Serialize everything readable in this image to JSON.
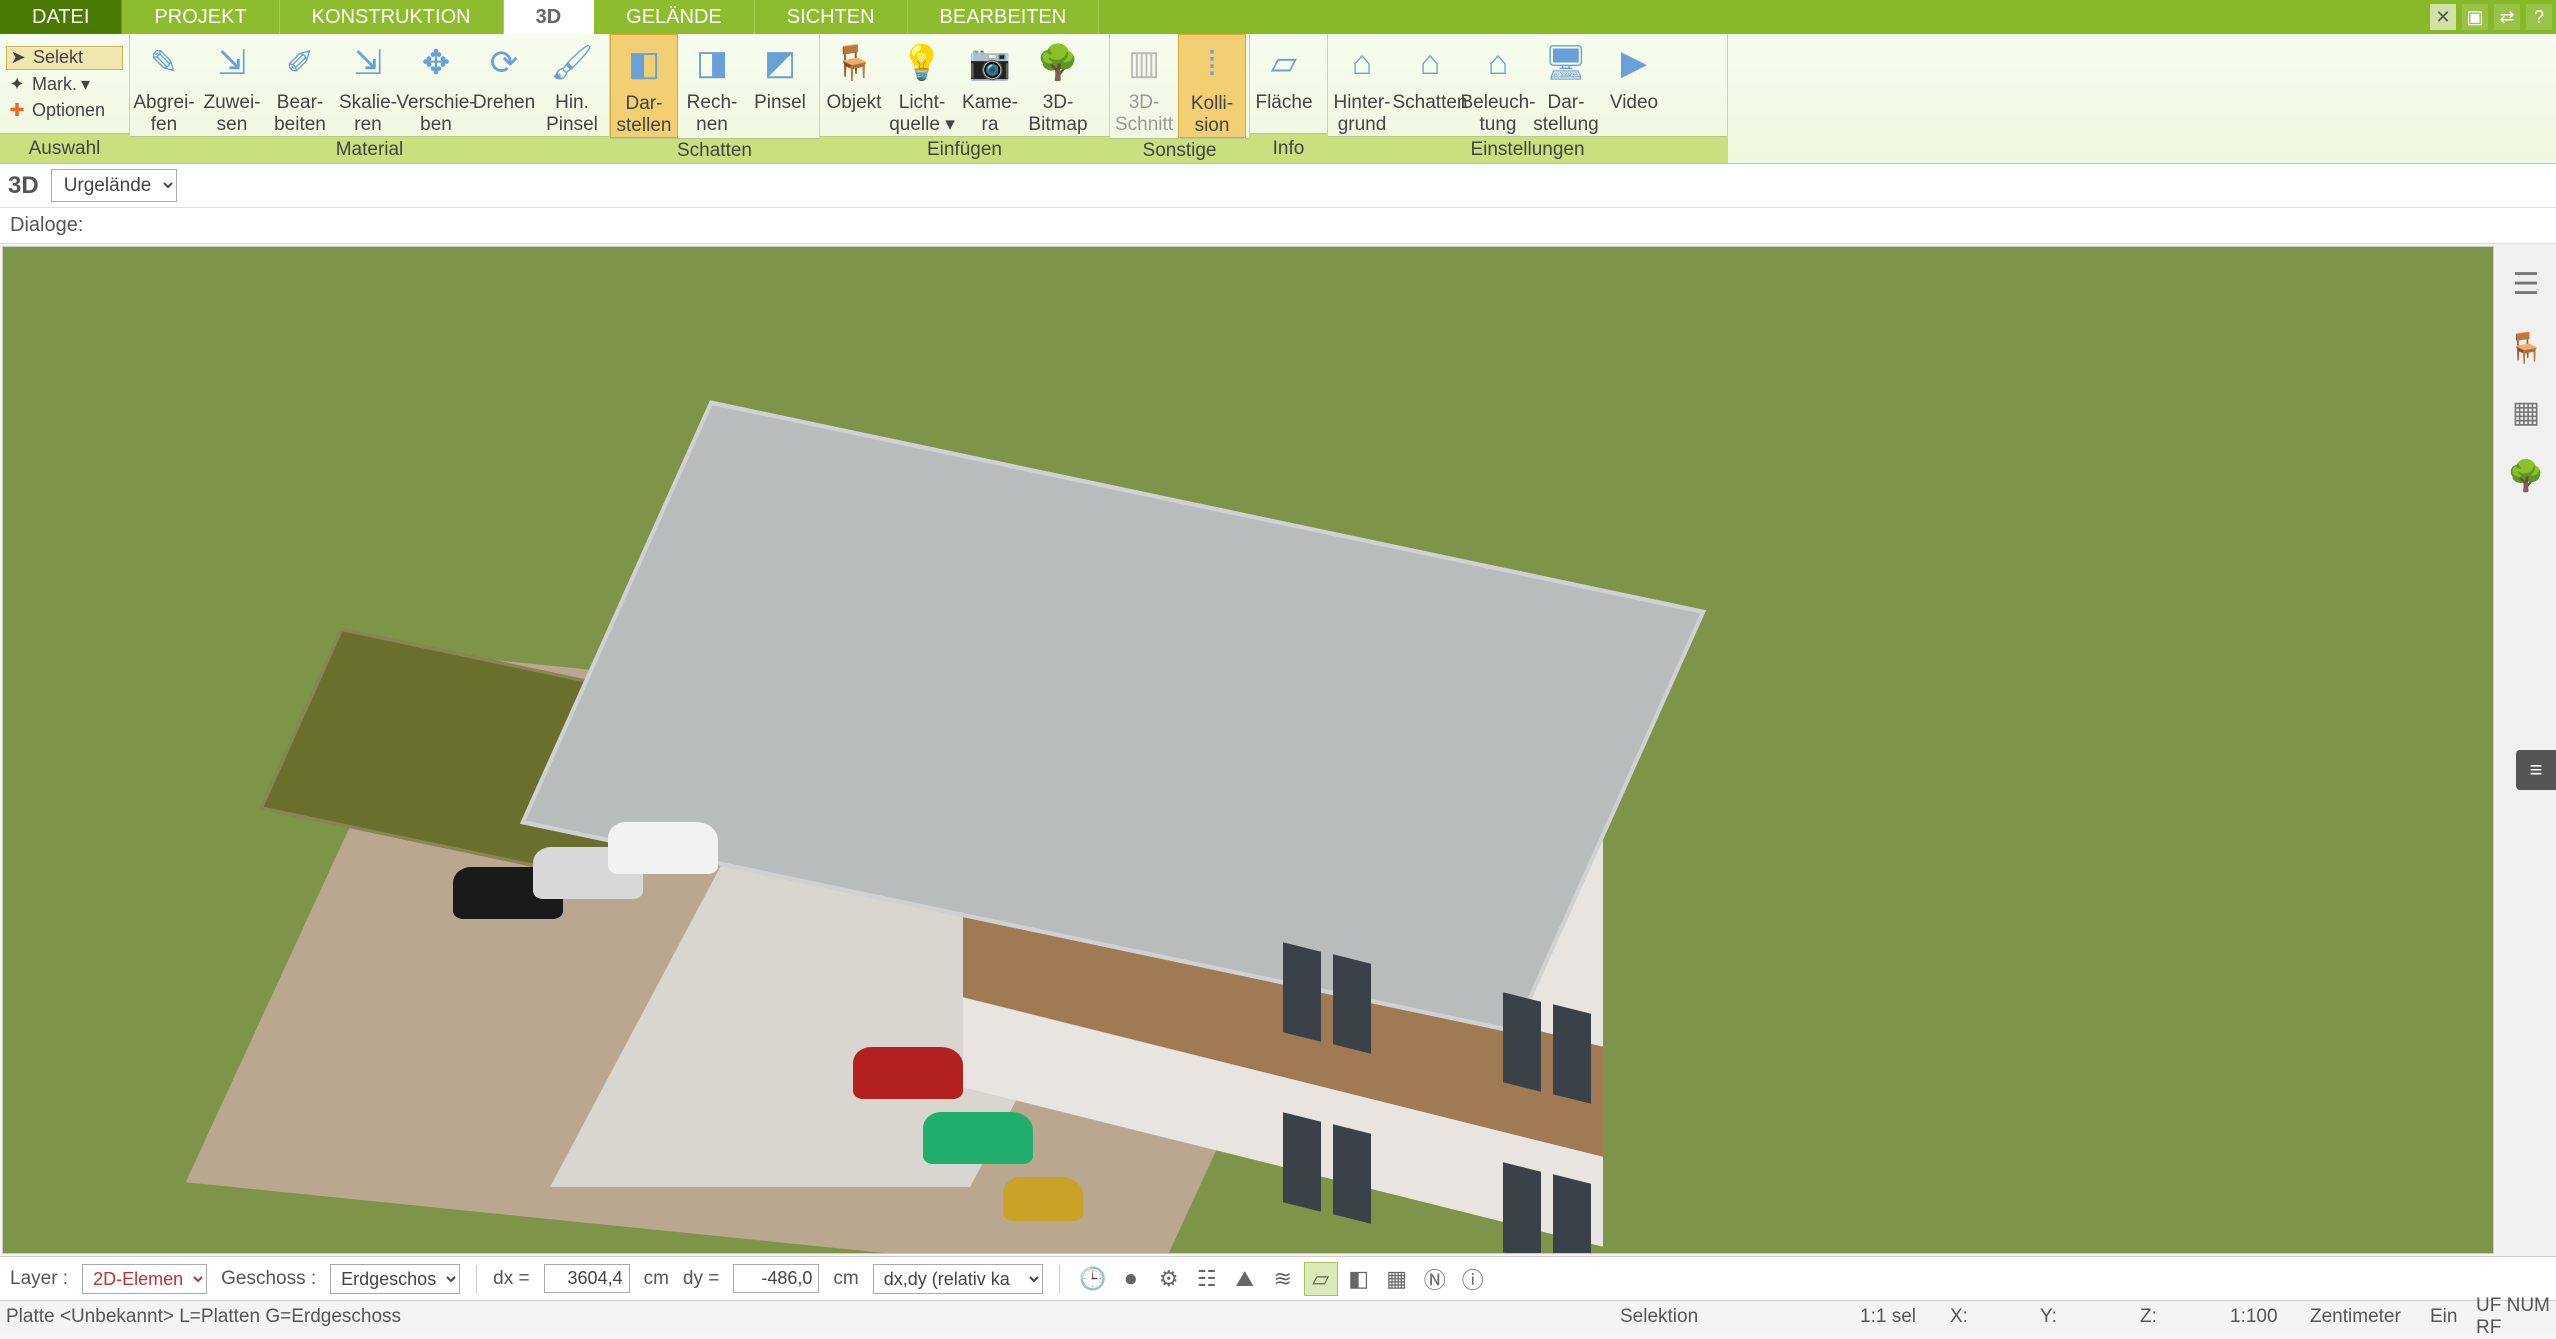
{
  "menu": {
    "tabs": [
      "DATEI",
      "PROJEKT",
      "KONSTRUKTION",
      "3D",
      "GELÄNDE",
      "SICHTEN",
      "BEARBEITEN"
    ],
    "active": "3D"
  },
  "title_icons": [
    "pin-icon",
    "layer-icon",
    "swap-icon",
    "help-icon",
    "minimize-icon",
    "restore-icon",
    "close-icon"
  ],
  "ribbon": {
    "auswahl": {
      "selekt": "Selekt",
      "mark": "Mark.",
      "optionen": "Optionen",
      "label": "Auswahl"
    },
    "material": {
      "tools": [
        {
          "id": "abgreifen",
          "l1": "Abgrei-",
          "l2": "fen",
          "icon": "eyedropper-icon"
        },
        {
          "id": "zuweisen",
          "l1": "Zuwei-",
          "l2": "sen",
          "icon": "assign-icon"
        },
        {
          "id": "bearbeiten",
          "l1": "Bear-",
          "l2": "beiten",
          "icon": "edit-icon"
        },
        {
          "id": "skalieren",
          "l1": "Skalie-",
          "l2": "ren",
          "icon": "scale-icon"
        },
        {
          "id": "verschieben",
          "l1": "Verschie-",
          "l2": "ben",
          "icon": "move-icon"
        },
        {
          "id": "drehen",
          "l1": "Drehen",
          "l2": "",
          "icon": "rotate-icon"
        },
        {
          "id": "hinpinsel",
          "l1": "Hin.",
          "l2": "Pinsel",
          "icon": "brush-icon"
        }
      ],
      "label": "Material"
    },
    "schatten": {
      "tools": [
        {
          "id": "darstellen",
          "l1": "Dar-",
          "l2": "stellen",
          "icon": "cube-icon",
          "active": true
        },
        {
          "id": "rechnen",
          "l1": "Rech-",
          "l2": "nen",
          "icon": "cube2-icon"
        },
        {
          "id": "pinsel",
          "l1": "Pinsel",
          "l2": "",
          "icon": "cube3-icon"
        }
      ],
      "label": "Schatten"
    },
    "einfuegen": {
      "tools": [
        {
          "id": "objekt",
          "l1": "Objekt",
          "l2": "",
          "icon": "chair-icon"
        },
        {
          "id": "lichtquelle",
          "l1": "Licht-",
          "l2": "quelle ▾",
          "icon": "bulb-icon"
        },
        {
          "id": "kamera",
          "l1": "Kame-",
          "l2": "ra",
          "icon": "camera-icon"
        },
        {
          "id": "3dbitmap",
          "l1": "3D-",
          "l2": "Bitmap",
          "icon": "tree-icon"
        }
      ],
      "label": "Einfügen"
    },
    "sonstige": {
      "tools": [
        {
          "id": "3dschnitt",
          "l1": "3D-",
          "l2": "Schnitt",
          "icon": "section-icon",
          "disabled": true
        },
        {
          "id": "kollision",
          "l1": "Kolli-",
          "l2": "sion",
          "icon": "collision-icon",
          "active": true
        }
      ],
      "label": "Sonstige"
    },
    "info": {
      "tools": [
        {
          "id": "flaeche",
          "l1": "Fläche",
          "l2": "",
          "icon": "area-icon"
        }
      ],
      "label": "Info"
    },
    "einstellungen": {
      "tools": [
        {
          "id": "hintergrund",
          "l1": "Hinter-",
          "l2": "grund",
          "icon": "house-bg-icon"
        },
        {
          "id": "schatten2",
          "l1": "Schatten",
          "l2": "",
          "icon": "house-shadow-icon"
        },
        {
          "id": "beleuchtung",
          "l1": "Beleuch-",
          "l2": "tung",
          "icon": "house-light-icon"
        },
        {
          "id": "darstellung",
          "l1": "Dar-",
          "l2": "stellung",
          "icon": "monitor-icon"
        },
        {
          "id": "video",
          "l1": "Video",
          "l2": "",
          "icon": "play-icon"
        }
      ],
      "label": "Einstellungen"
    }
  },
  "view": {
    "badge": "3D",
    "layer": "Urgelände"
  },
  "dialoge_label": "Dialoge:",
  "side_tools": [
    "layers-icon",
    "chair2-icon",
    "palette-icon",
    "tree2-icon"
  ],
  "bottom": {
    "layer_label": "Layer :",
    "layer_value": "2D-Elemen",
    "geschoss_label": "Geschoss :",
    "geschoss_value": "Erdgeschos",
    "dx_label": "dx  =",
    "dx_value": "3604,4",
    "dy_label": "dy  =",
    "dy_value": "-486,0",
    "unit": "cm",
    "mode_value": "dx,dy (relativ ka",
    "icons": [
      "clock-icon",
      "record-icon",
      "gear-icon",
      "layers2-icon",
      "mountain-icon",
      "dashline-icon",
      "plane-on-icon",
      "cube4-icon",
      "grid-icon",
      "north-icon",
      "info2-icon"
    ],
    "icon_states": [
      0,
      0,
      0,
      0,
      0,
      0,
      1,
      0,
      0,
      0,
      0
    ]
  },
  "status": {
    "left": "Platte  <Unbekannt>  L=Platten G=Erdgeschoss",
    "selektion": "Selektion",
    "sel_count": "1:1 sel",
    "coords": [
      "X:",
      "Y:",
      "Z:"
    ],
    "scale": "1:100",
    "unit": "Zentimeter",
    "ein": "Ein",
    "flags": "UF  NUM  RF"
  }
}
